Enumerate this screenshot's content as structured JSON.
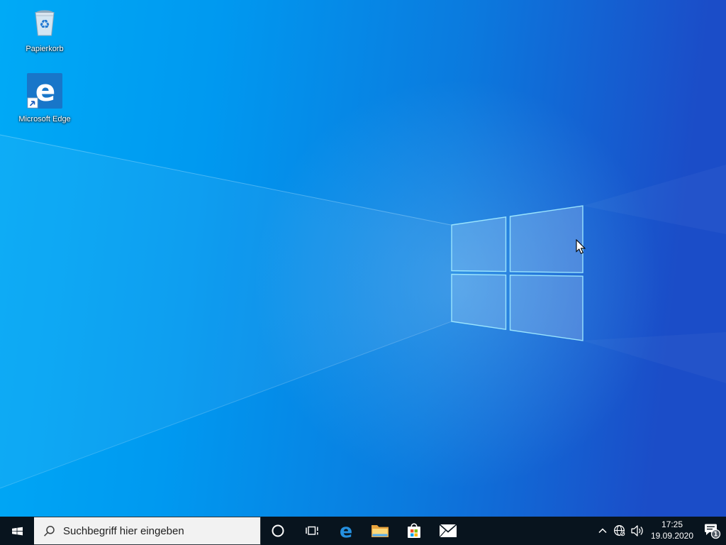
{
  "wallpaper": {
    "gradient_left": "#00aaf6",
    "gradient_right": "#1b4dc8",
    "logo_fill": "rgba(255,255,255,0.2)",
    "logo_edge_color": "#9fe9ff"
  },
  "desktop": {
    "icons": [
      {
        "id": "recycle-bin",
        "label": "Papierkorb"
      },
      {
        "id": "microsoft-edge-shortcut",
        "label": "Microsoft Edge"
      }
    ]
  },
  "taskbar": {
    "background": "#08141e",
    "start": {
      "icon": "windows-logo"
    },
    "search_placeholder": "Suchbegriff hier eingeben",
    "apps": [
      {
        "name": "cortana"
      },
      {
        "name": "task-view"
      },
      {
        "name": "microsoft-edge"
      },
      {
        "name": "file-explorer"
      },
      {
        "name": "microsoft-store"
      },
      {
        "name": "mail"
      }
    ],
    "tray": {
      "icons": [
        {
          "name": "hidden-icons-chevron"
        },
        {
          "name": "network-globe-offline"
        },
        {
          "name": "volume"
        }
      ],
      "clock": {
        "time": "17:25",
        "date": "19.09.2020"
      },
      "notification_badge": "1"
    }
  },
  "store_colors": {
    "red": "#f25022",
    "green": "#7fba00",
    "blue": "#00a4ef",
    "yellow": "#ffb900"
  }
}
